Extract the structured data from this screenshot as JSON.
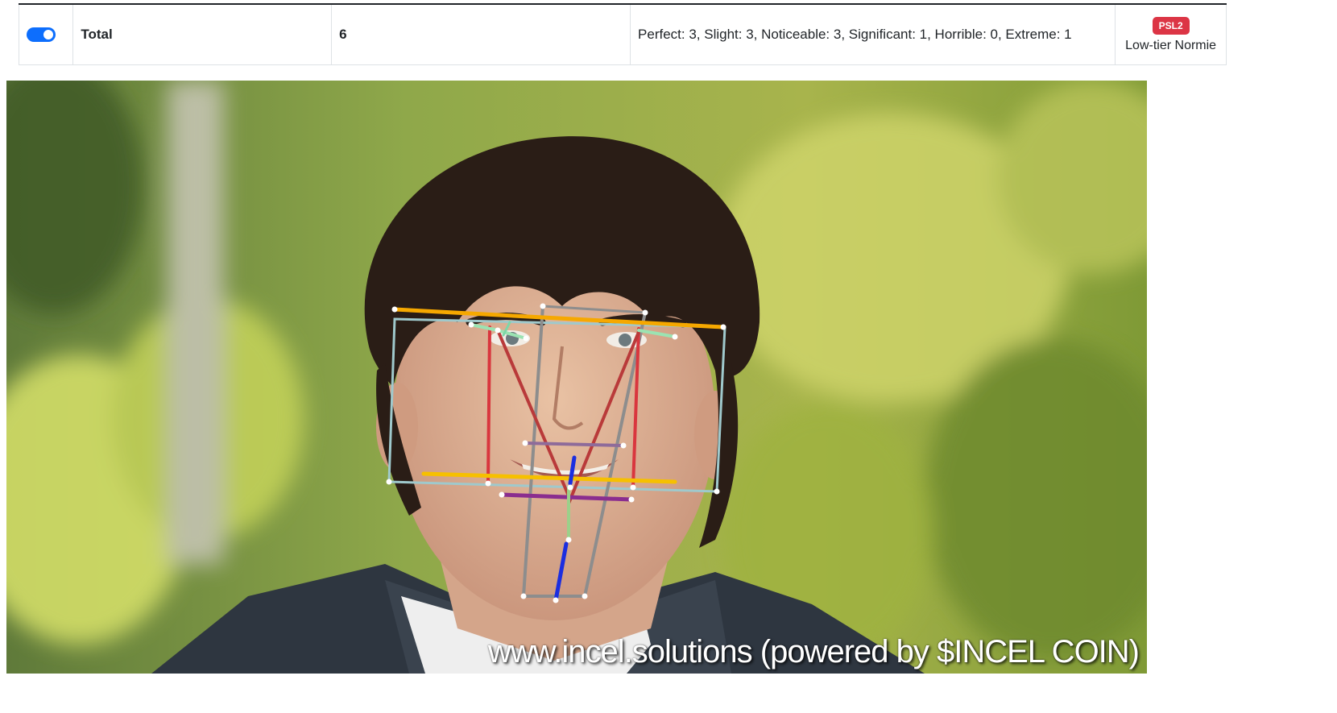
{
  "table": {
    "row": {
      "toggle_on": true,
      "label": "Total",
      "count": "6",
      "stats": "Perfect: 3, Slight: 3, Noticeable: 3, Significant: 1, Horrible: 0, Extreme: 1",
      "badge": "PSL2",
      "tier": "Low-tier Normie"
    }
  },
  "image": {
    "watermark": "www.incel.solutions (powered by $INCEL COIN)"
  },
  "colors": {
    "toggle_accent": "#0d6efd",
    "badge_red": "#dc3545"
  }
}
